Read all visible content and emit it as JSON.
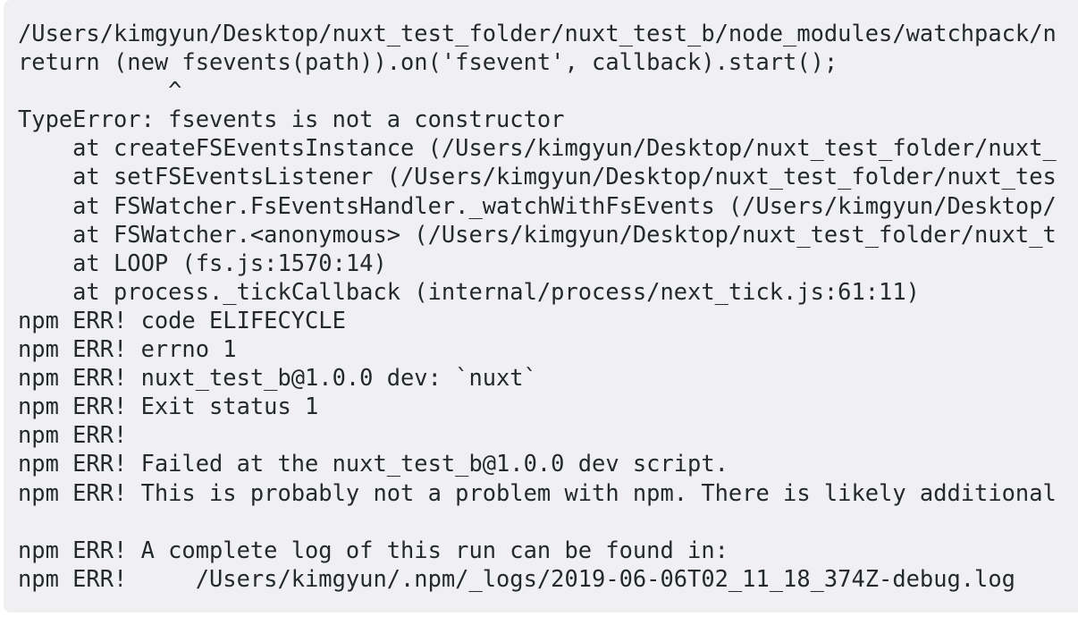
{
  "code_block": {
    "lines": [
      "/Users/kimgyun/Desktop/nuxt_test_folder/nuxt_test_b/node_modules/watchpack/n",
      "return (new fsevents(path)).on('fsevent', callback).start();",
      "           ^",
      "TypeError: fsevents is not a constructor",
      "    at createFSEventsInstance (/Users/kimgyun/Desktop/nuxt_test_folder/nuxt_",
      "    at setFSEventsListener (/Users/kimgyun/Desktop/nuxt_test_folder/nuxt_tes",
      "    at FSWatcher.FsEventsHandler._watchWithFsEvents (/Users/kimgyun/Desktop/",
      "    at FSWatcher.<anonymous> (/Users/kimgyun/Desktop/nuxt_test_folder/nuxt_t",
      "    at LOOP (fs.js:1570:14)",
      "    at process._tickCallback (internal/process/next_tick.js:61:11)",
      "npm ERR! code ELIFECYCLE",
      "npm ERR! errno 1",
      "npm ERR! nuxt_test_b@1.0.0 dev: `nuxt`",
      "npm ERR! Exit status 1",
      "npm ERR!",
      "npm ERR! Failed at the nuxt_test_b@1.0.0 dev script.",
      "npm ERR! This is probably not a problem with npm. There is likely additional",
      "",
      "npm ERR! A complete log of this run can be found in:",
      "npm ERR!     /Users/kimgyun/.npm/_logs/2019-06-06T02_11_18_374Z-debug.log"
    ]
  },
  "colors": {
    "background": "#f0f0f2",
    "text": "#24292e"
  }
}
